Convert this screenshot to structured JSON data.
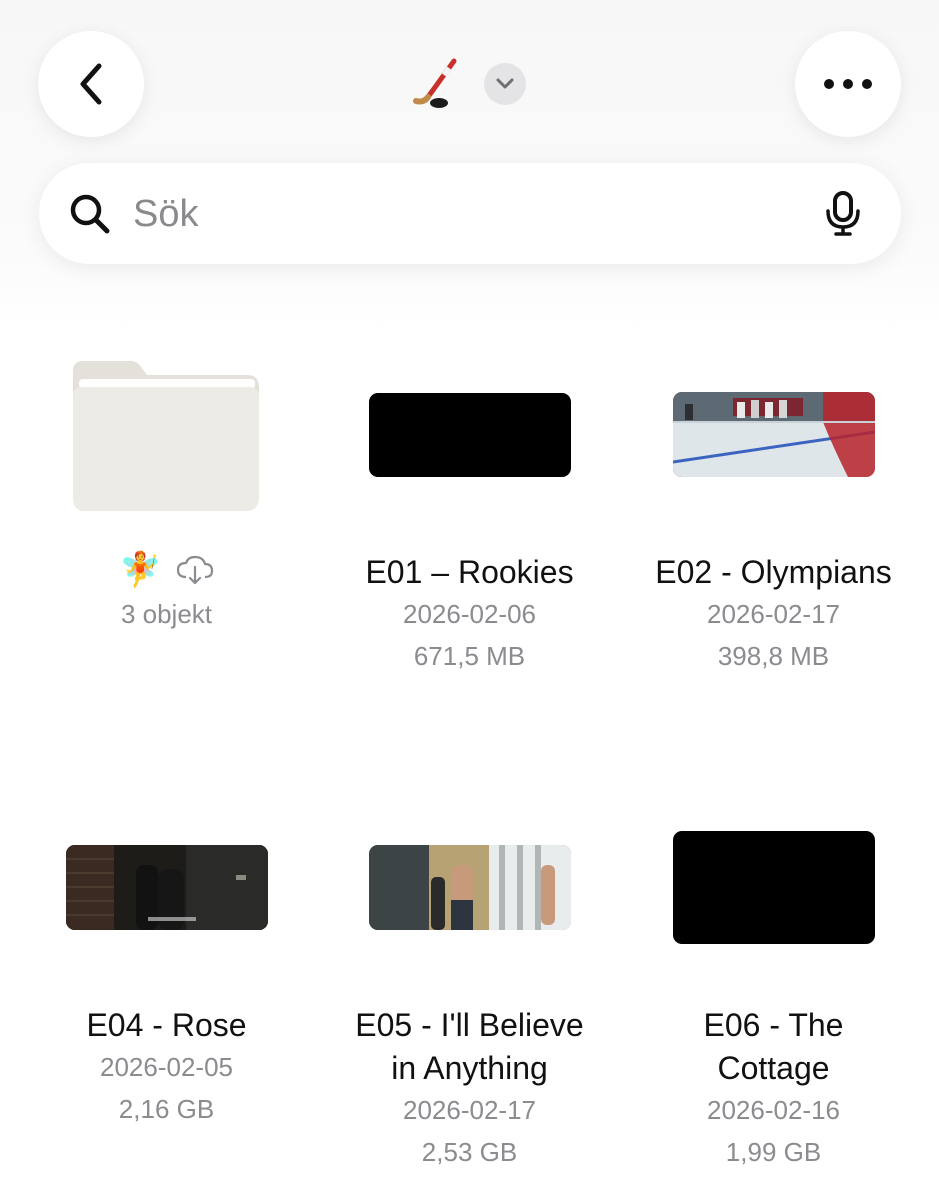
{
  "header": {
    "title_emoji": "🏒",
    "back_icon": "chevron-left-icon",
    "more_icon": "ellipsis-icon",
    "dropdown_icon": "chevron-down-icon"
  },
  "search": {
    "placeholder": "Sök",
    "value": ""
  },
  "folder": {
    "emoji": "🧚",
    "status_icon": "cloud-download-icon",
    "count": "3 objekt"
  },
  "files": [
    {
      "name": "E01 – Rookies",
      "date": "2026-02-06",
      "size": "671,5 MB"
    },
    {
      "name": "E02 - Olympians",
      "date": "2026-02-17",
      "size": "398,8 MB"
    },
    {
      "name": "E04 - Rose",
      "date": "2026-02-05",
      "size": "2,16 GB"
    },
    {
      "name_line1": "E05 - I'll Believe",
      "name_line2": "in Anything",
      "date": "2026-02-17",
      "size": "2,53 GB"
    },
    {
      "name_line1": "E06 - The",
      "name_line2": "Cottage",
      "date": "2026-02-16",
      "size": "1,99 GB"
    }
  ],
  "colors": {
    "folder": "#ecebe5",
    "ice_line": "#3a64c0",
    "jersey_red": "#b9222a"
  }
}
